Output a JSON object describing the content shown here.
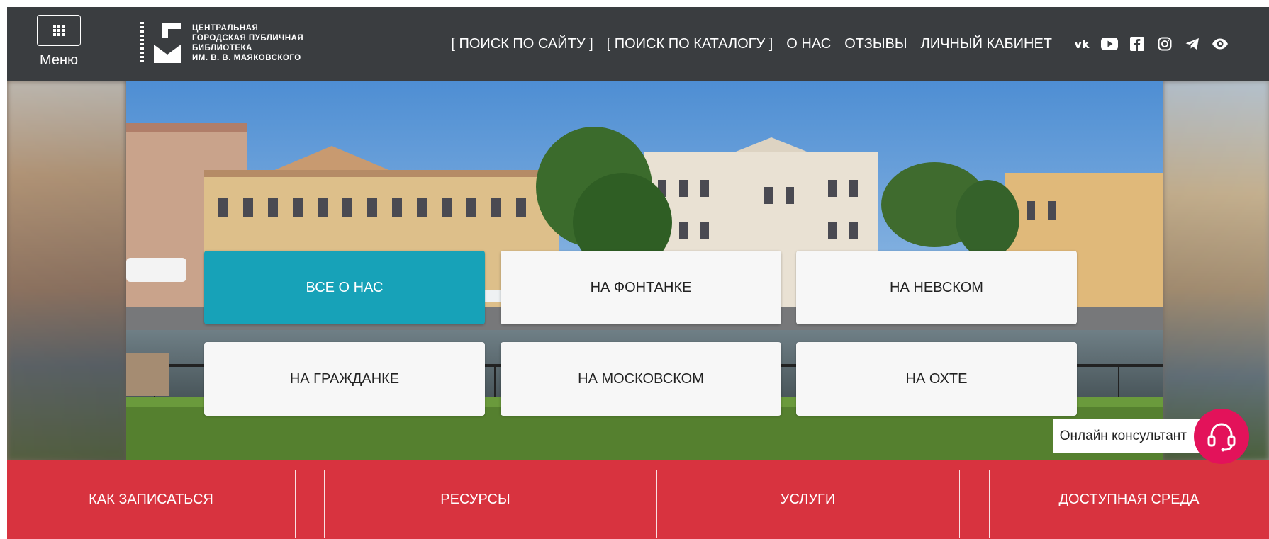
{
  "header": {
    "menu_label": "Меню",
    "logo_lines": [
      "ЦЕНТРАЛЬНАЯ",
      "ГОРОДСКАЯ ПУБЛИЧНАЯ",
      "БИБЛИОТЕКА",
      "ИМ. В. В. МАЯКОВСКОГО"
    ],
    "nav": {
      "site_search": "[ ПОИСК ПО САЙТУ ]",
      "catalog_search": "[ ПОИСК ПО КАТАЛОГУ ]",
      "about": "О НАС",
      "reviews": "ОТЗЫВЫ",
      "account": "ЛИЧНЫЙ КАБИНЕТ"
    },
    "social_icons": [
      "vk-icon",
      "youtube-icon",
      "facebook-icon",
      "instagram-icon",
      "telegram-icon",
      "eye-icon"
    ]
  },
  "tiles": {
    "all_about": "ВСЕ О НАС",
    "fontanka": "НА ФОНТАНКЕ",
    "nevsky": "НА НЕВСКОМ",
    "grazhdanka": "НА ГРАЖДАНКЕ",
    "moskovsky": "НА МОСКОВСКОМ",
    "okhta": "НА ОХТЕ"
  },
  "consultant": {
    "label": "Онлайн консультант"
  },
  "bottom_nav": {
    "how_to_join": "КАК ЗАПИСАТЬСЯ",
    "resources": "РЕСУРСЫ",
    "services": "УСЛУГИ",
    "accessible": "ДОСТУПНАЯ СРЕДА"
  },
  "colors": {
    "header_bg": "#3a3d40",
    "accent_teal": "#17a2b8",
    "bottom_bar": "#d8333f",
    "consultant_pink": "#e3125a"
  }
}
